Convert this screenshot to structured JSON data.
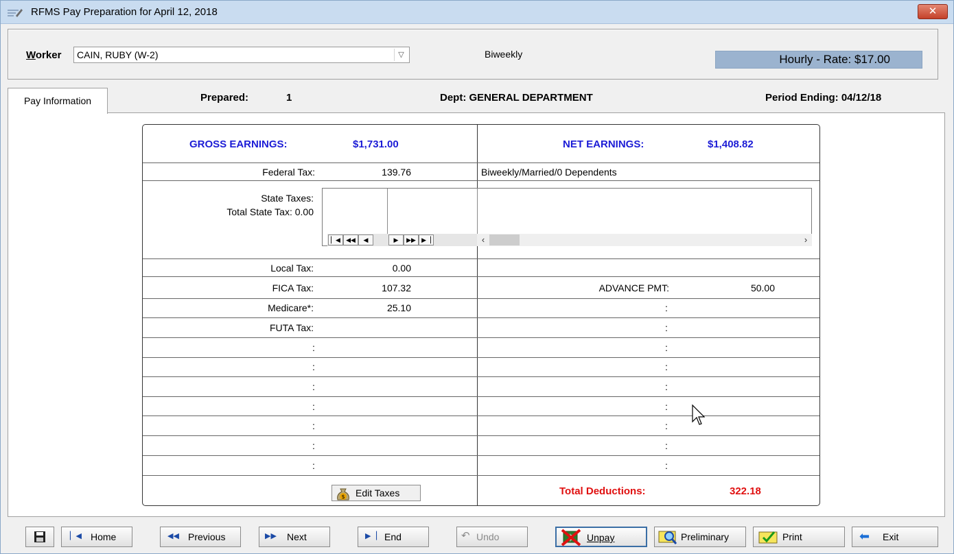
{
  "window": {
    "title": "RFMS Pay Preparation for April 12, 2018",
    "close_label": "✕"
  },
  "header": {
    "worker_label_first": "W",
    "worker_label_rest": "orker",
    "worker_value": "CAIN, RUBY (W-2)",
    "pay_frequency": "Biweekly",
    "rate": "Hourly - Rate: $17.00"
  },
  "tab": {
    "label": "Pay Information"
  },
  "info": {
    "prepared_label": "Prepared:",
    "prepared_value": "1",
    "dept": "Dept: GENERAL DEPARTMENT",
    "period_ending": "Period Ending: 04/12/18"
  },
  "summary": {
    "gross_label": "GROSS EARNINGS:",
    "gross_value": "$1,731.00",
    "net_label": "NET EARNINGS:",
    "net_value": "$1,408.82",
    "federal_label": "Federal Tax:",
    "federal_value": "139.76",
    "filing_status": "Biweekly/Married/0 Dependents",
    "state_label": "State Taxes:",
    "state_total": "Total State Tax: 0.00",
    "local_label": "Local Tax:",
    "local_value": "0.00",
    "fica_label": "FICA Tax:",
    "fica_value": "107.32",
    "medicare_label": "Medicare*:",
    "medicare_value": "25.10",
    "futa_label": "FUTA Tax:",
    "advance_label": "ADVANCE PMT:",
    "advance_value": "50.00",
    "colon": ":",
    "total_deductions_label": "Total Deductions:",
    "total_deductions_value": "322.18",
    "edit_taxes_label": "Edit Taxes"
  },
  "toolbar": {
    "home": "Home",
    "previous": "Previous",
    "next": "Next",
    "end": "End",
    "undo": "Undo",
    "unpay": "Unpay",
    "preliminary": "Preliminary",
    "print": "Print",
    "exit": "Exit"
  },
  "colors": {
    "header_blue": "#1c1cd6",
    "deduction_red": "#e01010",
    "rate_bg": "#9bb3cf"
  }
}
